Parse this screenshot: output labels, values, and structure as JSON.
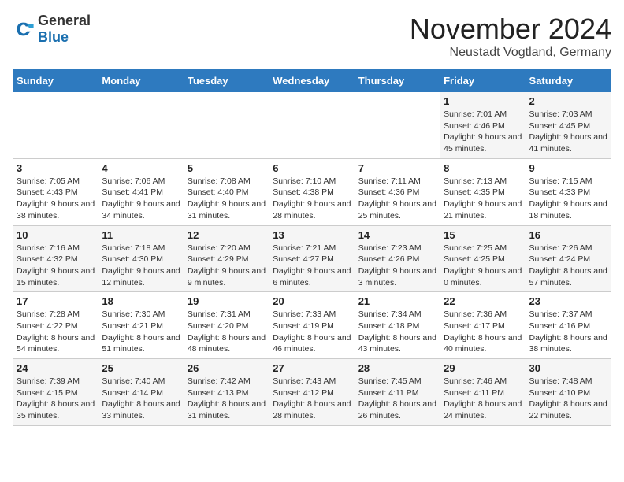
{
  "logo": {
    "general": "General",
    "blue": "Blue"
  },
  "title": "November 2024",
  "subtitle": "Neustadt Vogtland, Germany",
  "days_of_week": [
    "Sunday",
    "Monday",
    "Tuesday",
    "Wednesday",
    "Thursday",
    "Friday",
    "Saturday"
  ],
  "weeks": [
    [
      {
        "day": "",
        "info": ""
      },
      {
        "day": "",
        "info": ""
      },
      {
        "day": "",
        "info": ""
      },
      {
        "day": "",
        "info": ""
      },
      {
        "day": "",
        "info": ""
      },
      {
        "day": "1",
        "info": "Sunrise: 7:01 AM\nSunset: 4:46 PM\nDaylight: 9 hours and 45 minutes."
      },
      {
        "day": "2",
        "info": "Sunrise: 7:03 AM\nSunset: 4:45 PM\nDaylight: 9 hours and 41 minutes."
      }
    ],
    [
      {
        "day": "3",
        "info": "Sunrise: 7:05 AM\nSunset: 4:43 PM\nDaylight: 9 hours and 38 minutes."
      },
      {
        "day": "4",
        "info": "Sunrise: 7:06 AM\nSunset: 4:41 PM\nDaylight: 9 hours and 34 minutes."
      },
      {
        "day": "5",
        "info": "Sunrise: 7:08 AM\nSunset: 4:40 PM\nDaylight: 9 hours and 31 minutes."
      },
      {
        "day": "6",
        "info": "Sunrise: 7:10 AM\nSunset: 4:38 PM\nDaylight: 9 hours and 28 minutes."
      },
      {
        "day": "7",
        "info": "Sunrise: 7:11 AM\nSunset: 4:36 PM\nDaylight: 9 hours and 25 minutes."
      },
      {
        "day": "8",
        "info": "Sunrise: 7:13 AM\nSunset: 4:35 PM\nDaylight: 9 hours and 21 minutes."
      },
      {
        "day": "9",
        "info": "Sunrise: 7:15 AM\nSunset: 4:33 PM\nDaylight: 9 hours and 18 minutes."
      }
    ],
    [
      {
        "day": "10",
        "info": "Sunrise: 7:16 AM\nSunset: 4:32 PM\nDaylight: 9 hours and 15 minutes."
      },
      {
        "day": "11",
        "info": "Sunrise: 7:18 AM\nSunset: 4:30 PM\nDaylight: 9 hours and 12 minutes."
      },
      {
        "day": "12",
        "info": "Sunrise: 7:20 AM\nSunset: 4:29 PM\nDaylight: 9 hours and 9 minutes."
      },
      {
        "day": "13",
        "info": "Sunrise: 7:21 AM\nSunset: 4:27 PM\nDaylight: 9 hours and 6 minutes."
      },
      {
        "day": "14",
        "info": "Sunrise: 7:23 AM\nSunset: 4:26 PM\nDaylight: 9 hours and 3 minutes."
      },
      {
        "day": "15",
        "info": "Sunrise: 7:25 AM\nSunset: 4:25 PM\nDaylight: 9 hours and 0 minutes."
      },
      {
        "day": "16",
        "info": "Sunrise: 7:26 AM\nSunset: 4:24 PM\nDaylight: 8 hours and 57 minutes."
      }
    ],
    [
      {
        "day": "17",
        "info": "Sunrise: 7:28 AM\nSunset: 4:22 PM\nDaylight: 8 hours and 54 minutes."
      },
      {
        "day": "18",
        "info": "Sunrise: 7:30 AM\nSunset: 4:21 PM\nDaylight: 8 hours and 51 minutes."
      },
      {
        "day": "19",
        "info": "Sunrise: 7:31 AM\nSunset: 4:20 PM\nDaylight: 8 hours and 48 minutes."
      },
      {
        "day": "20",
        "info": "Sunrise: 7:33 AM\nSunset: 4:19 PM\nDaylight: 8 hours and 46 minutes."
      },
      {
        "day": "21",
        "info": "Sunrise: 7:34 AM\nSunset: 4:18 PM\nDaylight: 8 hours and 43 minutes."
      },
      {
        "day": "22",
        "info": "Sunrise: 7:36 AM\nSunset: 4:17 PM\nDaylight: 8 hours and 40 minutes."
      },
      {
        "day": "23",
        "info": "Sunrise: 7:37 AM\nSunset: 4:16 PM\nDaylight: 8 hours and 38 minutes."
      }
    ],
    [
      {
        "day": "24",
        "info": "Sunrise: 7:39 AM\nSunset: 4:15 PM\nDaylight: 8 hours and 35 minutes."
      },
      {
        "day": "25",
        "info": "Sunrise: 7:40 AM\nSunset: 4:14 PM\nDaylight: 8 hours and 33 minutes."
      },
      {
        "day": "26",
        "info": "Sunrise: 7:42 AM\nSunset: 4:13 PM\nDaylight: 8 hours and 31 minutes."
      },
      {
        "day": "27",
        "info": "Sunrise: 7:43 AM\nSunset: 4:12 PM\nDaylight: 8 hours and 28 minutes."
      },
      {
        "day": "28",
        "info": "Sunrise: 7:45 AM\nSunset: 4:11 PM\nDaylight: 8 hours and 26 minutes."
      },
      {
        "day": "29",
        "info": "Sunrise: 7:46 AM\nSunset: 4:11 PM\nDaylight: 8 hours and 24 minutes."
      },
      {
        "day": "30",
        "info": "Sunrise: 7:48 AM\nSunset: 4:10 PM\nDaylight: 8 hours and 22 minutes."
      }
    ]
  ]
}
